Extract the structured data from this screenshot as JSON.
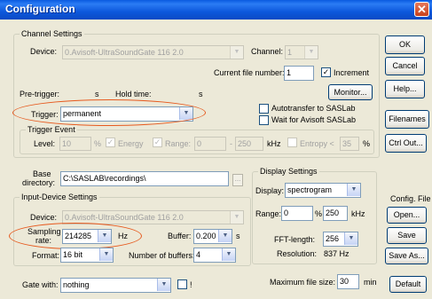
{
  "window": {
    "title": "Configuration",
    "close_glyph": "✕"
  },
  "buttons": {
    "ok": "OK",
    "cancel": "Cancel",
    "help": "Help...",
    "filenames": "Filenames",
    "ctrl_out": "Ctrl Out...",
    "monitor": "Monitor...",
    "browse": "...",
    "default": "Default"
  },
  "channel": {
    "group": "Channel Settings",
    "device_label": "Device:",
    "device_value": "0.Avisoft-UltraSoundGate 116 2.0",
    "channel_label": "Channel:",
    "channel_value": "1",
    "file_number_label": "Current file number:",
    "file_number_value": "1",
    "increment_label": "Increment",
    "pretrigger_label": "Pre-trigger:",
    "pretrigger_unit": "s",
    "holdtime_label": "Hold time:",
    "holdtime_unit": "s",
    "trigger_label": "Trigger:",
    "trigger_value": "permanent",
    "autotransfer_label": "Autotransfer to SASLab",
    "wait_label": "Wait for Avisoft SASLab",
    "increment_checked": "✓"
  },
  "trigger_event": {
    "group": "Trigger Event",
    "level_label": "Level:",
    "level_value": "10",
    "pct": "%",
    "energy_label": "Energy",
    "range_label": "Range:",
    "range_from": "0",
    "range_to": "250",
    "dash": "-",
    "khz": "kHz",
    "entropy_label": "Entropy <",
    "entropy_value": "35",
    "pct2": "%",
    "checked": "✓"
  },
  "base": {
    "label_line1": "Base",
    "label_line2": "directory:",
    "value": "C:\\SASLAB\\recordings\\"
  },
  "input": {
    "group": "Input-Device Settings",
    "device_label": "Device:",
    "device_value": "0.Avisoft-UltraSoundGate 116 2.0",
    "sampling_label_1": "Sampling",
    "sampling_label_2": "rate:",
    "sampling_value": "214285",
    "hz": "Hz",
    "buffer_label": "Buffer:",
    "buffer_value": "0.200",
    "buffer_unit": "s",
    "format_label": "Format:",
    "format_value": "16 bit",
    "nbuffers_label": "Number of buffers:",
    "nbuffers_value": "4"
  },
  "display": {
    "group": "Display Settings",
    "display_label": "Display:",
    "display_value": "spectrogram",
    "range_label": "Range:",
    "range_from": "0",
    "pct": "%",
    "range_to": "250",
    "khz": "kHz",
    "fft_label": "FFT-length:",
    "fft_value": "256",
    "resolution_label": "Resolution:",
    "resolution_value": "837 Hz"
  },
  "config_file": {
    "label": "Config. File",
    "open": "Open...",
    "save": "Save",
    "save_as": "Save As..."
  },
  "bottom": {
    "gate_label": "Gate with:",
    "gate_value": "nothing",
    "excl": "!",
    "maxsize_label": "Maximum file size:",
    "maxsize_value": "30",
    "min": "min"
  },
  "icons": {
    "dropdown": "chevron-down-icon",
    "close": "close-icon",
    "check": "check-icon"
  },
  "colors": {
    "title_bar": "#0a5be0",
    "highlight_oval": "#e65a1f",
    "dialog_bg": "#ece9d8"
  }
}
